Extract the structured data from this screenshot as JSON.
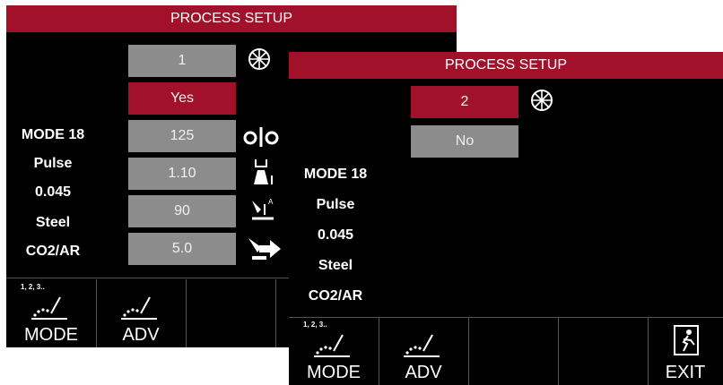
{
  "screen1": {
    "title": "PROCESS SETUP",
    "fields": [
      "1",
      "Yes",
      "125",
      "1.10",
      "90",
      "5.0"
    ],
    "labels": [
      "MODE 18",
      "Pulse",
      "0.045",
      "Steel",
      "CO2/AR"
    ],
    "buttons": {
      "mode_label": "MODE",
      "mode_sub": "1, 2, 3..",
      "adv_label": "ADV"
    }
  },
  "screen2": {
    "title": "PROCESS SETUP",
    "fields": [
      "2",
      "No"
    ],
    "labels": [
      "MODE 18",
      "Pulse",
      "0.045",
      "Steel",
      "CO2/AR"
    ],
    "buttons": {
      "mode_label": "MODE",
      "mode_sub": "1, 2, 3..",
      "adv_label": "ADV",
      "exit_label": "EXIT"
    }
  },
  "colors": {
    "accent": "#a2112a",
    "field_gray": "#8c8c8c",
    "background": "#000000"
  },
  "icons": [
    "memory-dial-icon",
    "run-in-icon",
    "gun-trigger-icon",
    "arc-control-icon",
    "wire-feed-icon",
    "mode-icon",
    "adv-icon",
    "exit-icon"
  ]
}
